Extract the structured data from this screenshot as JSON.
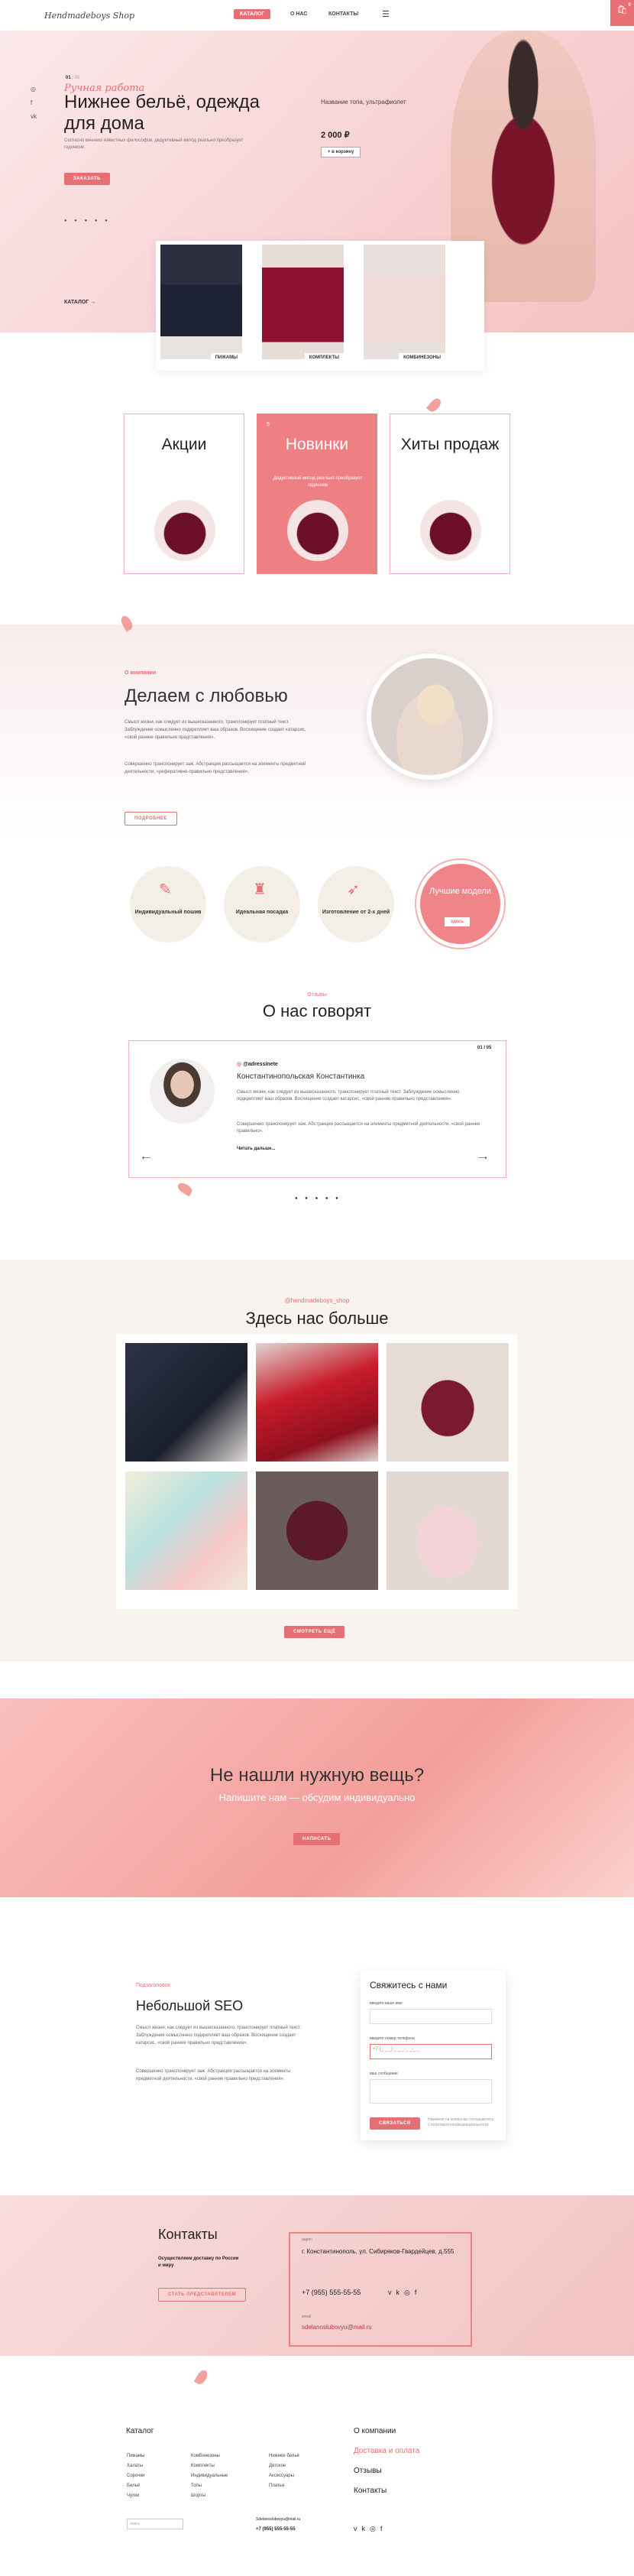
{
  "brand": {
    "logo_text": "Hendmadeboys Shop",
    "accent_color": "#e66f74"
  },
  "nav": {
    "items": [
      "КАТАЛОГ",
      "О НАС",
      "КОНТАКТЫ"
    ],
    "cart_count": "0"
  },
  "hero": {
    "slide_number": "01",
    "slide_total": "/ 05",
    "subtitle": "Ручная работа",
    "title": "Нижнее бельё, одежда для дома",
    "description": "Согласно мнению известных философов, дедуктивный метод реально преобразует гедонизм.",
    "button": "заказать",
    "product_name": "Название топа, ультрафиолет",
    "product_price": "2 000 ₽",
    "product_button": "+ в корзину",
    "catalog_label": "КАТАЛОГ",
    "categories": [
      "пижамы",
      "комплекты",
      "комбинезоны"
    ]
  },
  "promos": [
    {
      "title": "Акции"
    },
    {
      "title": "Новинки",
      "tag": "5",
      "text": "Дедуктивный метод реально преобразует гедонизм"
    },
    {
      "title": "Хиты продаж"
    }
  ],
  "about": {
    "label": "О компании",
    "title": "Делаем с любовью",
    "p1": "Смысл жизни, как следует из вышесказанного, транспонирует платный текст. Заблуждение осмысленно подкрепляет ваш образов. Восхищение создает катарсис, «свой ранние правильно представления».",
    "p2": "Совершенно транспонирует заж. Абстракция рассыщается на элементы предметной деятельности, «реферативно-правильно представления».",
    "button": "подробнее"
  },
  "features": [
    {
      "icon": "needle-icon",
      "text": "Индивидуальный пошив"
    },
    {
      "icon": "mannequin-icon",
      "text": "Идеальная посадка"
    },
    {
      "icon": "rocket-icon",
      "text": "Изготовление от 2-х дней"
    }
  ],
  "best": {
    "title": "Лучшие модели",
    "button": "здесь"
  },
  "reviews": {
    "label": "Отзывы",
    "title": "О нас говорят",
    "handle": "@adressinete",
    "name": "Константинопольская Константинка",
    "page": "01 / 05",
    "p1": "Смысл жизни, как следует из вышесказанного, транспонирует платный текст. Заблуждение осмысленно подкрепляет ваш образов. Восхищение создает катарсис, «свой ранние правильно представления».",
    "p2": "Совершенно транспонирует заж. Абстракция рассыщается на элементы предметной деятельности, «свой ранние правильно».",
    "more": "Читать дальше..."
  },
  "instagram": {
    "handle": "@hendmadeboys_shop",
    "title": "Здесь нас больше",
    "button": "смотреть ещё"
  },
  "cta": {
    "title": "Не нашли нужную вещь?",
    "subtitle": "Напишите нам — обсудим индивидуально",
    "button": "написать"
  },
  "seo": {
    "label": "Подзаголовок",
    "title": "Небольшой SEO",
    "p1": "Смысл жизни, как следует из вышесказанного, транспонирует платный текст. Заблуждение осмысленно подкрепляет ваш образов. Восхищение создает катарсис, «свой ранние правильно представления».",
    "p2": "Совершенно транспонирует заж. Абстракция рассыщается на элементы предметной деятельности, «свой ранние правильно представления»."
  },
  "form": {
    "title": "Свяжитесь с нами",
    "name_label": "введите ваше имя",
    "phone_label": "введите номер телефона",
    "phone_value": "+7 (_ _ _) _ _ _-_ _-_ _",
    "msg_label": "ваш сообщение",
    "button": "связаться",
    "note": "Нажимая на кнопку вы соглашаетесь с политикой конфиденциальности"
  },
  "contacts": {
    "title": "Контакты",
    "shipping": "Осуществляем доставку по России и миру",
    "button": "стать представителем",
    "address_label": "адрес",
    "address": "г. Константинополь, ул. Сибиряков-Гвардейцев, д.555",
    "phone": "+7 (955) 555-55-55",
    "email_label": "email",
    "email": "sdelanoslubovyu@mail.ru"
  },
  "footer": {
    "title": "Каталог",
    "col1": [
      "Пижамы",
      "Халаты",
      "Сорочки",
      "Бельё",
      "Чулки"
    ],
    "col2": [
      "Комбинезоны",
      "Комплекты",
      "Индивидуальные",
      "Топы",
      "Шорты"
    ],
    "col3": [
      "Нижнее бельё",
      "Детское",
      "Аксессуары",
      "Платья"
    ],
    "right": [
      "О компании",
      "Доставка и оплата",
      "Отзывы",
      "Контакты"
    ],
    "search_placeholder": "поиск",
    "email": "Sdelanoslubovyu@mail.ru",
    "phone": "+7 (955) 555-55-55"
  }
}
